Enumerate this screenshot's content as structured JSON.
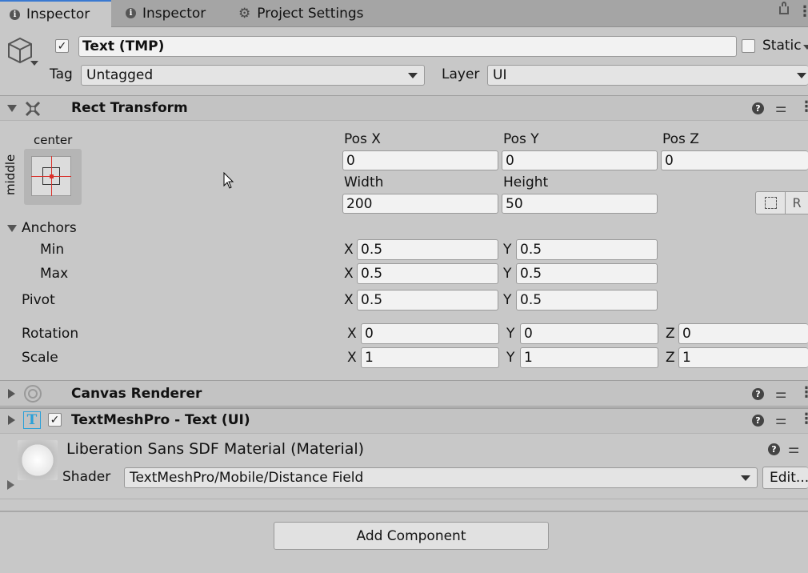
{
  "tabs": [
    {
      "label": "Inspector",
      "icon": "info-icon"
    },
    {
      "label": "Inspector",
      "icon": "info-icon"
    },
    {
      "label": "Project Settings",
      "icon": "gear-icon"
    }
  ],
  "object": {
    "name": "Text (TMP)",
    "static_label": "Static",
    "tag_label": "Tag",
    "tag_value": "Untagged",
    "layer_label": "Layer",
    "layer_value": "UI"
  },
  "rect_transform": {
    "title": "Rect Transform",
    "anchor_h": "center",
    "anchor_v": "middle",
    "pos_x_label": "Pos X",
    "pos_x": "0",
    "pos_y_label": "Pos Y",
    "pos_y": "0",
    "pos_z_label": "Pos Z",
    "pos_z": "0",
    "width_label": "Width",
    "width": "200",
    "height_label": "Height",
    "height": "50",
    "r_button": "R",
    "anchors_label": "Anchors",
    "min_label": "Min",
    "min_x": "0.5",
    "min_y": "0.5",
    "max_label": "Max",
    "max_x": "0.5",
    "max_y": "0.5",
    "pivot_label": "Pivot",
    "pivot_x": "0.5",
    "pivot_y": "0.5",
    "rotation_label": "Rotation",
    "rot_x": "0",
    "rot_y": "0",
    "rot_z": "0",
    "scale_label": "Scale",
    "scale_x": "1",
    "scale_y": "1",
    "scale_z": "1",
    "x": "X",
    "y": "Y",
    "z": "Z"
  },
  "canvas_renderer": {
    "title": "Canvas Renderer"
  },
  "textmeshpro": {
    "title": "TextMeshPro - Text (UI)",
    "icon_letter": "T"
  },
  "material": {
    "title": "Liberation Sans SDF Material (Material)",
    "shader_label": "Shader",
    "shader_value": "TextMeshPro/Mobile/Distance Field",
    "edit_button": "Edit..."
  },
  "add_component": "Add Component",
  "colors": {
    "tab_accent": "#3a79d1",
    "anchor_red": "#d9302a",
    "tmp_icon": "#2aa0d8"
  }
}
